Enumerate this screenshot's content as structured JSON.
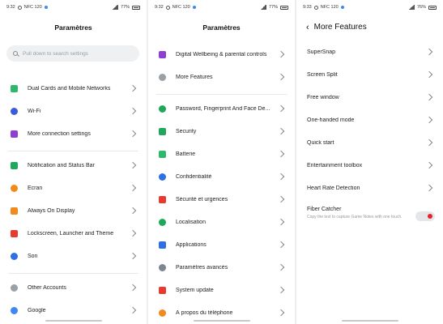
{
  "panels": [
    {
      "status": {
        "time": "9:32",
        "nfc": "NFC 120",
        "battery": "77%"
      },
      "title": "Paramètres",
      "search_placeholder": "Pull down to search settings",
      "groups": [
        [
          {
            "label": "Dual Cards and Mobile Networks",
            "icon": "sim-card-icon",
            "color": "#2db86a"
          },
          {
            "label": "Wi-Fi",
            "icon": "wifi-icon",
            "color": "#3b5bdb"
          },
          {
            "label": "More connection settings",
            "icon": "connection-icon",
            "color": "#8e3fd1"
          }
        ],
        [
          {
            "label": "Notification and Status Bar",
            "icon": "notification-icon",
            "color": "#1fa85a"
          },
          {
            "label": "Écran",
            "icon": "sun-icon",
            "color": "#f28a1b"
          },
          {
            "label": "Always On Display",
            "icon": "phone-icon",
            "color": "#f08a1e"
          },
          {
            "label": "Lockscreen, Launcher and Theme",
            "icon": "home-icon",
            "color": "#e63b2e"
          },
          {
            "label": "Son",
            "icon": "speaker-icon",
            "color": "#2f6fe4"
          }
        ],
        [
          {
            "label": "Other Accounts",
            "icon": "account-icon",
            "color": "#9aa0a6"
          },
          {
            "label": "Google",
            "icon": "google-icon",
            "color": "#4285f4"
          }
        ]
      ]
    },
    {
      "status": {
        "time": "9:32",
        "nfc": "NFC 120",
        "battery": "77%"
      },
      "title": "Paramètres",
      "groups": [
        [
          {
            "label": "Digital Wellbeing & parental controls",
            "icon": "hourglass-icon",
            "color": "#8e3fd1"
          },
          {
            "label": "More Features",
            "icon": "dots-icon",
            "color": "#9aa0a6"
          }
        ],
        [
          {
            "label": "Password, Fingerprint And Face De...",
            "icon": "fingerprint-icon",
            "color": "#1fa85a"
          },
          {
            "label": "Security",
            "icon": "shield-icon",
            "color": "#1fa85a"
          },
          {
            "label": "Batterie",
            "icon": "battery-icon",
            "color": "#2db86a"
          },
          {
            "label": "Confidentialité",
            "icon": "privacy-icon",
            "color": "#2f6fe4"
          },
          {
            "label": "Sécurité et urgences",
            "icon": "emergency-icon",
            "color": "#e63b2e"
          },
          {
            "label": "Localisation",
            "icon": "location-icon",
            "color": "#1fa85a"
          },
          {
            "label": "Applications",
            "icon": "apps-icon",
            "color": "#2f6fe4"
          },
          {
            "label": "Paramètres avancés",
            "icon": "gear-icon",
            "color": "#7d8590"
          },
          {
            "label": "System update",
            "icon": "update-icon",
            "color": "#e63b2e"
          },
          {
            "label": "À propos du téléphone",
            "icon": "info-icon",
            "color": "#f08a1e"
          }
        ]
      ]
    },
    {
      "status": {
        "time": "9:33",
        "nfc": "NFC 120",
        "battery": "76%"
      },
      "title": "More Features",
      "items": [
        "SuperSnap",
        "Screen Split",
        "Free window",
        "One-handed mode",
        "Quick start",
        "Entertainment toolbox",
        "Heart Rate Detection"
      ],
      "fiber": {
        "title": "Fiber Catcher",
        "desc": "Copy the text to capture Game Notes with one touch."
      }
    }
  ]
}
